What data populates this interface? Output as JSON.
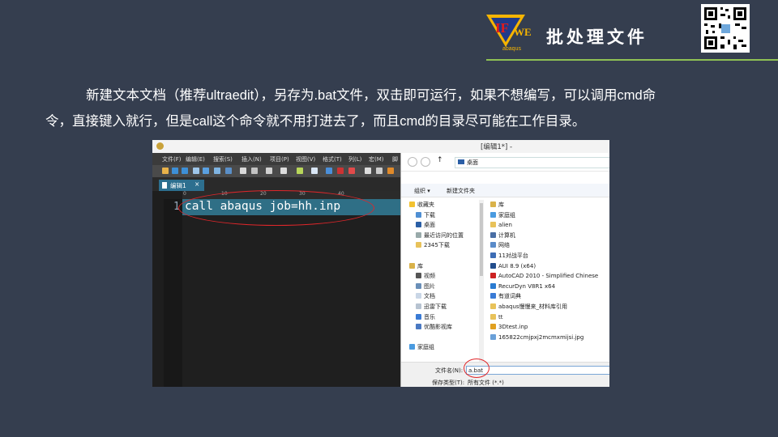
{
  "header": {
    "logo_text": "IFWE",
    "logo_sub": "abaqus",
    "title": "批处理文件"
  },
  "paragraph": {
    "line1": "新建文本文档（推荐ultraedit），另存为.bat文件，双击即可运行，如果不想编写，可以调用cmd命",
    "line2": "令，直接键入就行，但是call这个命令就不用打进去了，而且cmd的目录尽可能在工作目录。"
  },
  "editor": {
    "window_title": "[编辑1*] -",
    "menu": [
      "文件(F)",
      "编辑(E)",
      "搜索(S)",
      "插入(N)",
      "项目(P)",
      "视图(V)",
      "格式(T)",
      "列(L)",
      "宏(M)",
      "脚"
    ],
    "tab_label": "编辑1",
    "tab_close": "×",
    "ruler_marks": [
      "0",
      "10",
      "20",
      "30",
      "40"
    ],
    "line_number": "1",
    "code": "call abaqus job=hh.inp"
  },
  "save_dialog": {
    "address": "桌面",
    "organize": "组织 ▾",
    "new_folder": "新建文件夹",
    "tree": [
      "收藏夹",
      "下载",
      "桌面",
      "最近访问的位置",
      "2345下载",
      "",
      "库",
      "视频",
      "图片",
      "文档",
      "迅雷下载",
      "音乐",
      "优酷影视库",
      "",
      "家庭组"
    ],
    "files": [
      "库",
      "家庭组",
      "alien",
      "计算机",
      "网络",
      "11对战平台",
      "AUI 8.9 (x64)",
      "AutoCAD 2010 - Simplified Chinese",
      "RecurDyn V8R1 x64",
      "有道词典",
      "abaqus慢慢来_材料库引用",
      "tt",
      "3Dtest.inp",
      "165822cmjpxj2mcmxmijsi.jpg"
    ],
    "filename_label": "文件名(N):",
    "filename_value": "a.bat",
    "filetype_label": "保存类型(T):",
    "filetype_value": "所有文件 (*.*)"
  },
  "colors": {
    "background": "#353e4f",
    "accent_line": "#8fc154",
    "highlight": "#e0262a",
    "editor_line": "#2f6f86"
  }
}
